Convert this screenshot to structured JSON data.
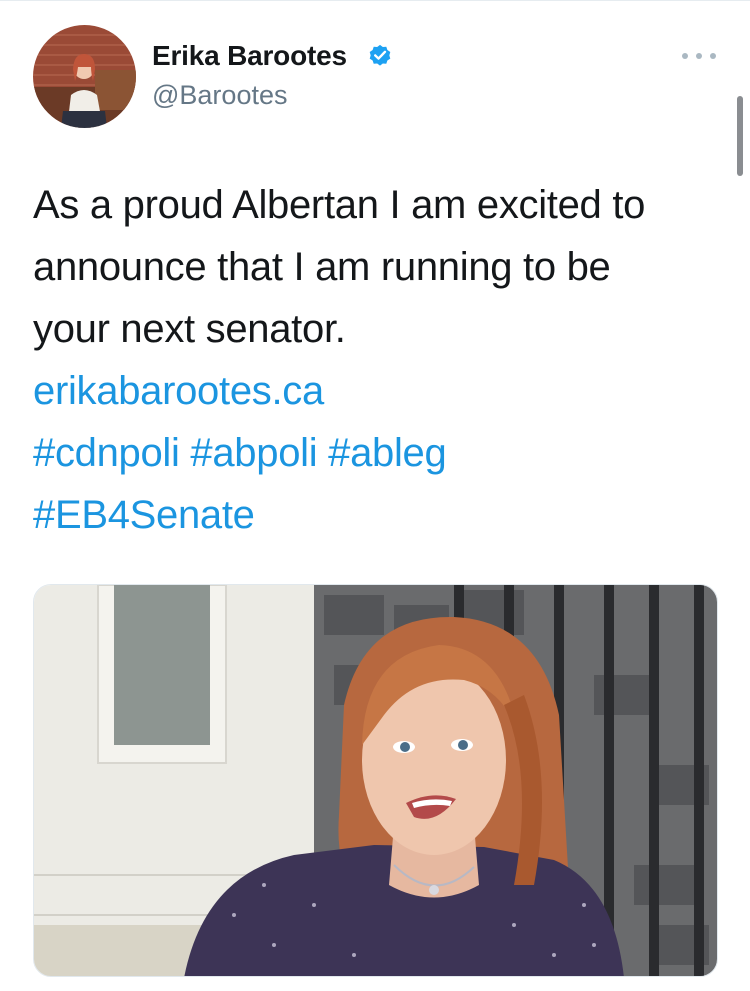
{
  "author": {
    "name": "Erika Barootes",
    "handle": "@Barootes",
    "verified": true
  },
  "tweet": {
    "text_lines": [
      "As a proud Albertan I am excited to",
      "announce that I am running to be",
      "your next senator."
    ],
    "link": "erikabarootes.ca",
    "hashtag_line_1": "#cdnpoli #abpoli #ableg",
    "hashtag_line_2": "#EB4Senate"
  },
  "icons": {
    "verified": "verified-badge-icon",
    "more": "more-options-icon"
  },
  "colors": {
    "link": "#1b95e0",
    "handle": "#657786",
    "verified": "#1da1f2"
  }
}
